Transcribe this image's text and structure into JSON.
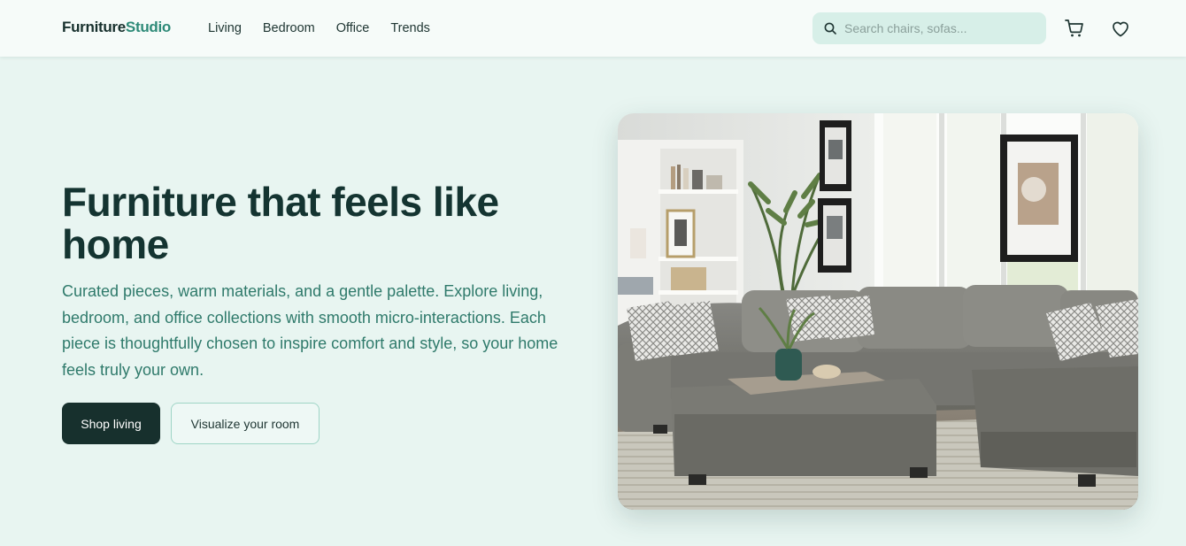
{
  "brand": {
    "part1": "Furniture",
    "part2": "Studio"
  },
  "nav": {
    "items": [
      "Living",
      "Bedroom",
      "Office",
      "Trends"
    ]
  },
  "search": {
    "placeholder": "Search chairs, sofas..."
  },
  "header_icons": [
    "cart-icon",
    "heart-icon"
  ],
  "hero": {
    "title": "Furniture that feels like home",
    "description": "Curated pieces, warm materials, and a gentle palette. Explore living, bedroom, and office collections with smooth micro-interactions. Each piece is thoughtfully chosen to inspire comfort and style, so your home feels truly your own.",
    "primary_button": "Shop living",
    "secondary_button": "Visualize your room",
    "image_subject": "grey sectional sofa with ottoman in bright living room"
  },
  "colors": {
    "page_bg": "#e8f5f1",
    "header_bg": "#f6fbf9",
    "brand_dark": "#17302d",
    "brand_accent": "#2e8a78",
    "body_text": "#2f7a6b",
    "search_bg": "#d7efe8"
  }
}
